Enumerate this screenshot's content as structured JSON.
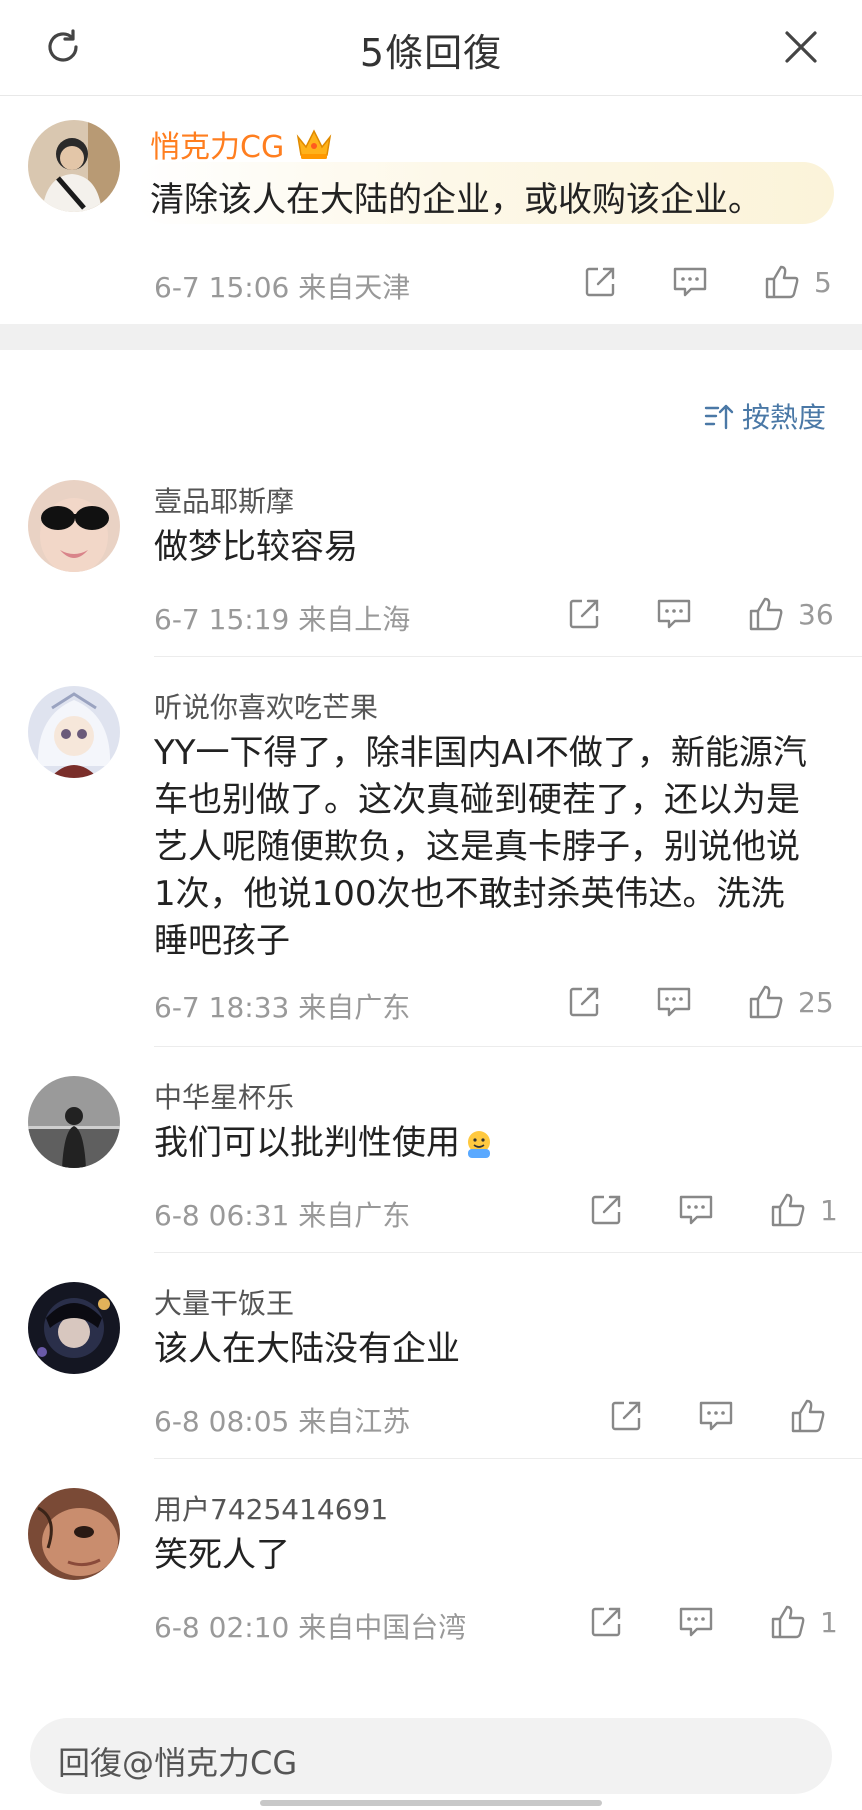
{
  "header": {
    "title": "5條回復"
  },
  "root_comment": {
    "username": "悄克力CG",
    "text": "清除该人在大陆的企业，或收购该企业。",
    "time_location": "6-7 15:06  来自天津",
    "likes": "5"
  },
  "sort": {
    "label": "按熱度"
  },
  "replies": [
    {
      "username": "壹品耶斯摩",
      "text": "做梦比较容易",
      "time_location": "6-7 15:19  来自上海",
      "likes": "36"
    },
    {
      "username": "听说你喜欢吃芒果",
      "text": "YY一下得了，除非国内AI不做了，新能源汽车也别做了。这次真碰到硬茬了，还以为是艺人呢随便欺负，这是真卡脖子，别说他说1次，他说100次也不敢封杀英伟达。洗洗睡吧孩子",
      "time_location": "6-7 18:33  来自广东",
      "likes": "25"
    },
    {
      "username": "中华星杯乐",
      "text": "我们可以批判性使用",
      "time_location": "6-8 06:31  来自广东",
      "likes": "1"
    },
    {
      "username": "大量干饭王",
      "text": "该人在大陆没有企业",
      "time_location": "6-8 08:05  来自江苏",
      "likes": ""
    },
    {
      "username": "用户7425414691",
      "text": "笑死人了",
      "time_location": "6-8 02:10  来自中国台湾",
      "likes": "1"
    }
  ],
  "reply_input": {
    "placeholder": "回復@悄克力CG"
  },
  "colors": {
    "accent_username": "#ff7e1f",
    "sort_blue": "#4a78a6",
    "meta_gray": "#999999"
  },
  "icons": [
    "refresh-icon",
    "close-icon",
    "crown-icon",
    "share-icon",
    "comment-icon",
    "like-icon",
    "sort-icon",
    "emoji-icon"
  ]
}
